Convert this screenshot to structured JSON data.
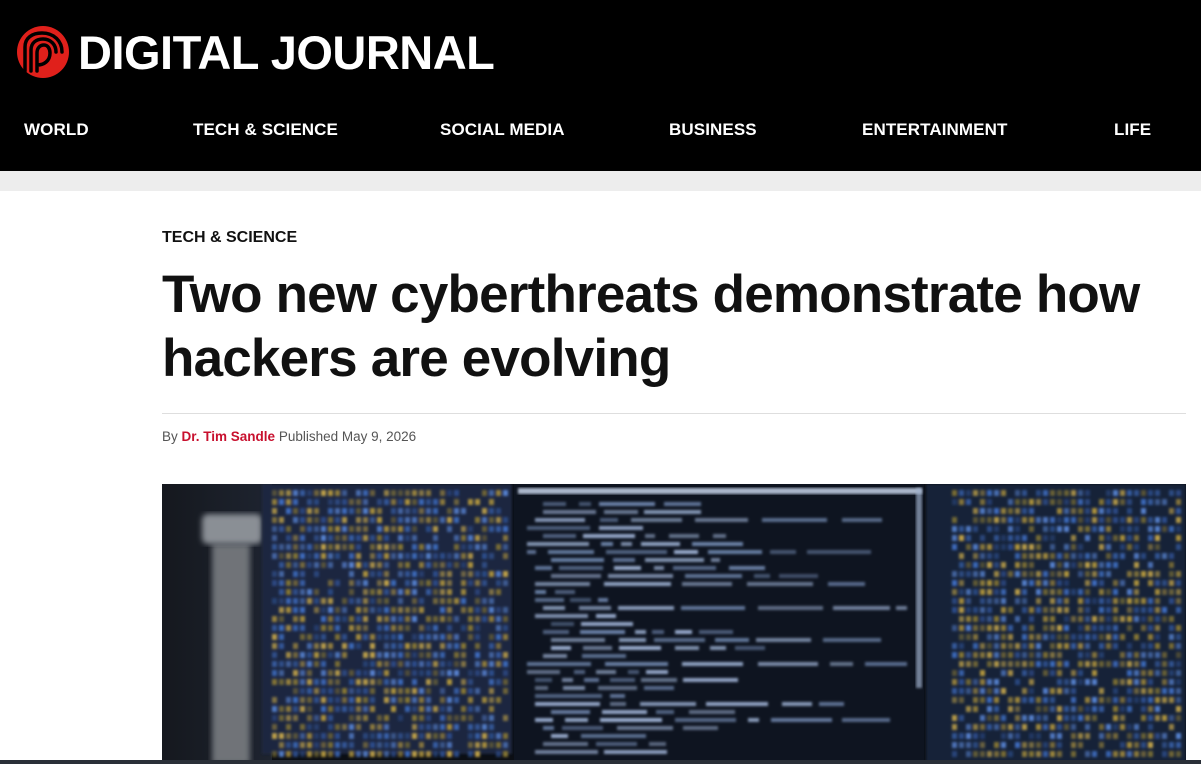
{
  "site": {
    "brand_name": "DIGITAL JOURNAL",
    "brand_color": "#e0201b"
  },
  "nav": {
    "items": [
      {
        "label": "WORLD"
      },
      {
        "label": "TECH & SCIENCE"
      },
      {
        "label": "SOCIAL MEDIA"
      },
      {
        "label": "BUSINESS"
      },
      {
        "label": "ENTERTAINMENT"
      },
      {
        "label": "LIFE"
      }
    ]
  },
  "article": {
    "category": "TECH & SCIENCE",
    "headline": "Two new cyberthreats demonstrate how hackers are evolving",
    "byline": {
      "by": "By",
      "author": "Dr. Tim Sandle",
      "published_label": "Published",
      "date": "May 9, 2026"
    },
    "hero_image": {
      "icon": "hero-image"
    }
  },
  "colors": {
    "header_bg": "#000000",
    "accent": "#c8102e",
    "text": "#111111"
  }
}
